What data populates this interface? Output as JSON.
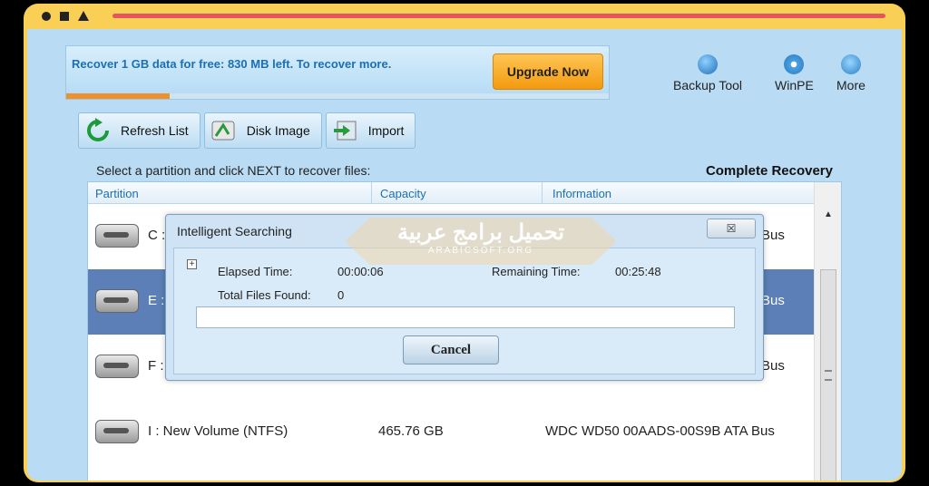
{
  "promo": {
    "text": "Recover 1 GB data for free: 830 MB left. To recover more.",
    "upgrade_label": "Upgrade Now",
    "free_quota_used_fraction": 0.19
  },
  "topnav": [
    {
      "label": "Backup Tool",
      "icon": "backup-icon"
    },
    {
      "label": "WinPE",
      "icon": "disc-icon"
    },
    {
      "label": "More",
      "icon": "more-icon"
    }
  ],
  "toolbar": {
    "refresh_label": "Refresh List",
    "disk_image_label": "Disk Image",
    "import_label": "Import"
  },
  "instruction": "Select a partition and click NEXT to recover files:",
  "mode_title": "Complete Recovery",
  "table": {
    "headers": [
      "Partition",
      "Capacity",
      "Information"
    ],
    "rows": [
      {
        "partition": "C :",
        "capacity": "",
        "info": "Bus",
        "selected": false
      },
      {
        "partition": "E :",
        "capacity": "",
        "info": "Bus",
        "selected": true
      },
      {
        "partition": "F :",
        "capacity": "",
        "info": "Bus",
        "selected": false
      },
      {
        "partition": "I : New Volume  (NTFS)",
        "capacity": "465.76 GB",
        "info": "WDC WD50  00AADS-00S9B  ATA Bus",
        "selected": false
      }
    ]
  },
  "dialog": {
    "title": "Intelligent Searching",
    "elapsed_label": "Elapsed Time:",
    "elapsed_value": "00:00:06",
    "remaining_label": "Remaining Time:",
    "remaining_value": "00:25:48",
    "files_label": "Total Files Found:",
    "files_value": "0",
    "cancel_label": "Cancel",
    "close_glyph": "☒"
  },
  "watermark": {
    "main": "تحميل برامج عربية",
    "sub": "ARABICSOFT.ORG"
  },
  "colors": {
    "frame": "#f9cf56",
    "app_bg": "#b9dcf4",
    "accent": "#1c6fb3",
    "upgrade": "#f39a10",
    "selected_row": "#5b7fb6"
  }
}
